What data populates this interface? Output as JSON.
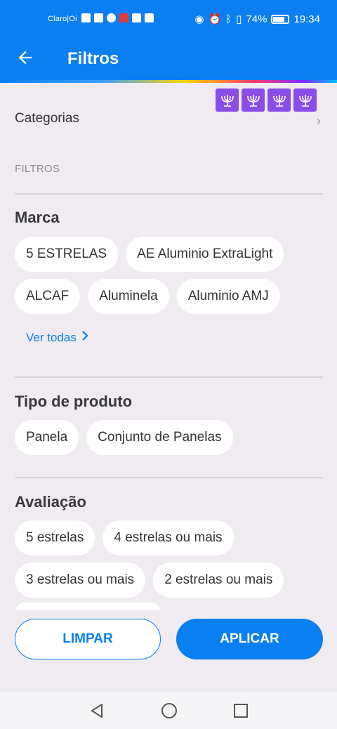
{
  "status_bar": {
    "carrier": "Claro|Oi",
    "battery": "74%",
    "time": "19:34"
  },
  "app_bar": {
    "title": "Filtros",
    "back_icon": "arrow-left-icon"
  },
  "categories_row": {
    "label": "Categorias"
  },
  "filters_caption": "FILTROS",
  "brand": {
    "heading": "Marca",
    "chips_row1": [
      "5 ESTRELAS",
      "AE Aluminio ExtraLight"
    ],
    "chips_row2": [
      "ALCAF",
      "Aluminela",
      "Aluminio AMJ"
    ],
    "see_all": "Ver todas"
  },
  "product_type": {
    "heading": "Tipo de produto",
    "chips": [
      "Panela",
      "Conjunto de Panelas"
    ]
  },
  "rating": {
    "heading": "Avaliação",
    "chips_row1": [
      "5 estrelas",
      "4 estrelas ou mais"
    ],
    "chips_row2": [
      "3 estrelas ou mais",
      "2 estrelas ou mais"
    ]
  },
  "actions": {
    "clear_label": "LIMPAR",
    "apply_label": "APLICAR"
  },
  "colors": {
    "accent": "#0a7ff2",
    "badge": "#8a4ee8",
    "background": "#efebf1"
  }
}
